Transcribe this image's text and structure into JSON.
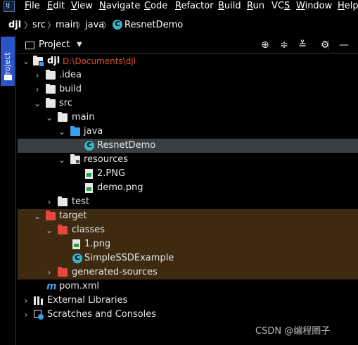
{
  "menu": [
    "File",
    "Edit",
    "View",
    "Navigate",
    "Code",
    "Refactor",
    "Build",
    "Run",
    "VCS",
    "Window",
    "Help"
  ],
  "menu_mnemonics": [
    "F",
    "E",
    "V",
    "N",
    "C",
    "R",
    "B",
    "R",
    "S",
    "W",
    "H"
  ],
  "breadcrumbs": [
    "djl",
    "src",
    "main",
    "java",
    "ResnetDemo"
  ],
  "side_tab": "Project",
  "tool_window": {
    "title": "Project",
    "dropdown_icon": "triangle-down-icon",
    "buttons": [
      "locate-icon",
      "expand-all-icon",
      "collapse-all-icon",
      "gear-icon",
      "hide-icon"
    ]
  },
  "tree": [
    {
      "label": "djl",
      "path": "D:\\Documents\\djl",
      "icon": "module-folder-icon",
      "expanded": true,
      "selected": false,
      "excluded": false
    },
    {
      "label": ".idea",
      "icon": "folder-icon",
      "expanded": false
    },
    {
      "label": "build",
      "icon": "folder-icon",
      "expanded": false
    },
    {
      "label": "src",
      "icon": "folder-icon",
      "expanded": true
    },
    {
      "label": "main",
      "icon": "folder-icon",
      "expanded": true
    },
    {
      "label": "java",
      "icon": "source-folder-icon",
      "expanded": true
    },
    {
      "label": "ResnetDemo",
      "icon": "class-icon",
      "selected": true
    },
    {
      "label": "resources",
      "icon": "resources-folder-icon",
      "expanded": true
    },
    {
      "label": "2.PNG",
      "icon": "image-file-icon"
    },
    {
      "label": "demo.png",
      "icon": "image-file-icon"
    },
    {
      "label": "test",
      "icon": "folder-icon",
      "expanded": false
    },
    {
      "label": "target",
      "icon": "excluded-folder-icon",
      "expanded": true,
      "excluded": true
    },
    {
      "label": "classes",
      "icon": "excluded-folder-icon",
      "expanded": true,
      "excluded": true
    },
    {
      "label": "1.png",
      "icon": "image-file-icon",
      "excluded": true
    },
    {
      "label": "SimpleSSDExample",
      "icon": "class-icon",
      "excluded": true
    },
    {
      "label": "generated-sources",
      "icon": "excluded-folder-icon",
      "expanded": false,
      "excluded": true
    },
    {
      "label": "pom.xml",
      "icon": "maven-icon"
    },
    {
      "label": "External Libraries",
      "icon": "library-icon",
      "expanded": false
    },
    {
      "label": "Scratches and Consoles",
      "icon": "scratches-icon",
      "expanded": false
    }
  ],
  "watermark": "CSDN @编程圈子",
  "colors": {
    "selected_row": "#3c3f41",
    "excluded_row": "#3d2a10",
    "project_path": "#d7512c",
    "side_tab": "#2b55c6",
    "class_icon": "#39b5c8"
  }
}
